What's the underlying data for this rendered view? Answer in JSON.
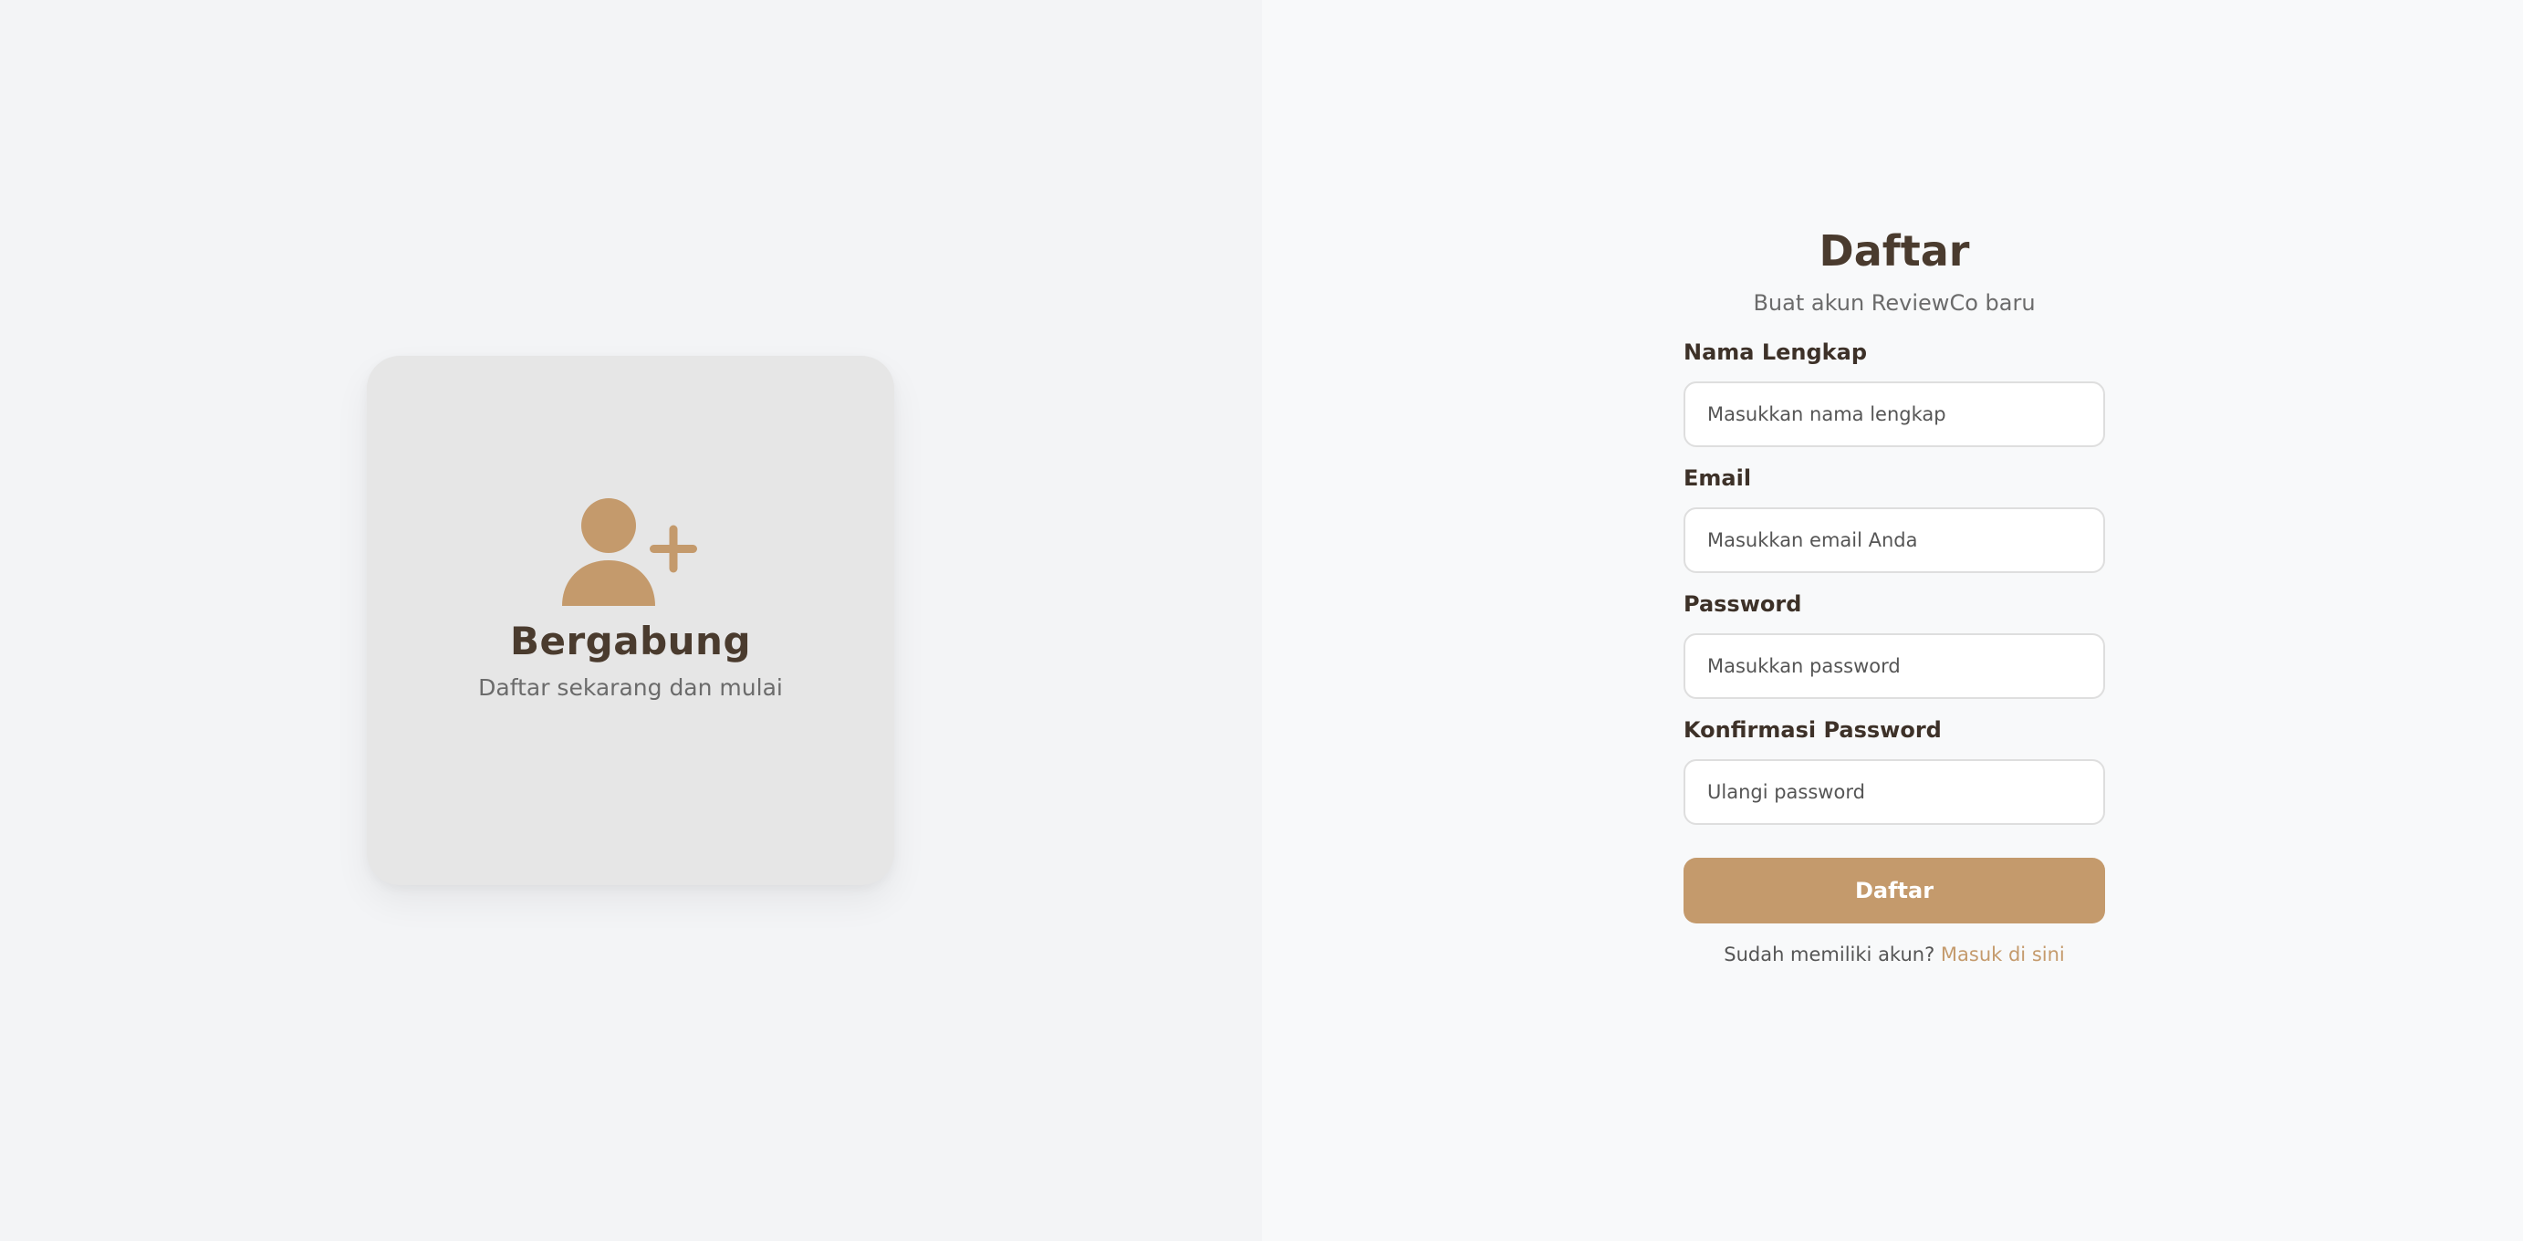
{
  "left": {
    "icon": "user-plus-icon",
    "title": "Bergabung",
    "subtitle": "Daftar sekarang dan mulai"
  },
  "form": {
    "title": "Daftar",
    "subtitle": "Buat akun ReviewCo baru",
    "fields": [
      {
        "label": "Nama Lengkap",
        "placeholder": "Masukkan nama lengkap",
        "value": ""
      },
      {
        "label": "Email",
        "placeholder": "Masukkan email Anda",
        "value": ""
      },
      {
        "label": "Password",
        "placeholder": "Masukkan password",
        "value": ""
      },
      {
        "label": "Konfirmasi Password",
        "placeholder": "Ulangi password",
        "value": ""
      }
    ],
    "submit_label": "Daftar",
    "login_prompt": "Sudah memiliki akun?",
    "login_link": "Masuk di sini"
  },
  "colors": {
    "accent": "#c49a6c",
    "heading": "#4a3b2e",
    "card_bg": "#e6e6e6",
    "left_bg": "#f3f4f6",
    "right_bg": "#f8f9fa"
  }
}
